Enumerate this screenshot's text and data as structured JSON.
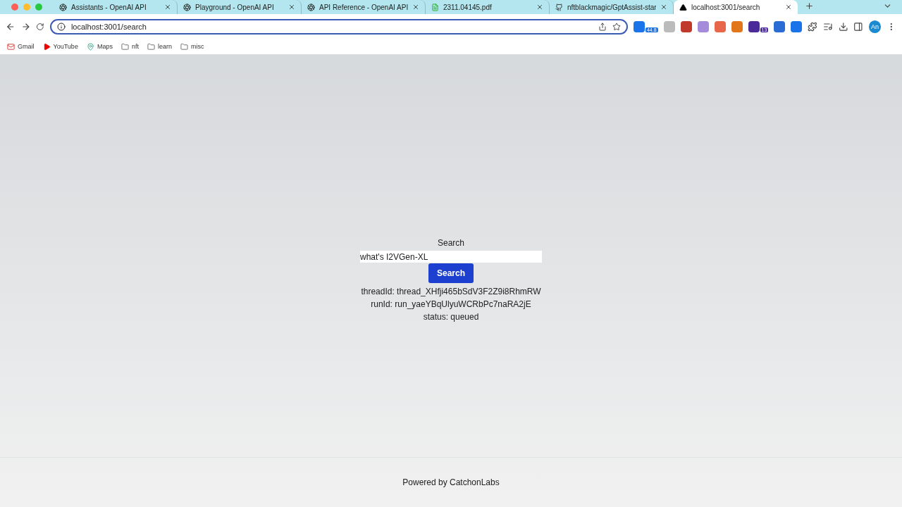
{
  "tabs": [
    {
      "title": "Assistants - OpenAI API",
      "kind": "openai",
      "selected": false
    },
    {
      "title": "Playground - OpenAI API",
      "kind": "openai",
      "selected": false
    },
    {
      "title": "API Reference - OpenAI API",
      "kind": "openai",
      "selected": false
    },
    {
      "title": "2311.04145.pdf",
      "kind": "pdf",
      "selected": false
    },
    {
      "title": "nftblackmagic/GptAssist-star",
      "kind": "github",
      "selected": false
    },
    {
      "title": "localhost:3001/search",
      "kind": "triangle",
      "selected": true
    }
  ],
  "address_bar": {
    "url": "localhost:3001/search"
  },
  "extensions": [
    {
      "kind": "badge",
      "badge": "44.8",
      "color": "#1a73e8"
    },
    {
      "kind": "plain",
      "color": "#bbbbbb"
    },
    {
      "kind": "plain",
      "color": "#c0392b"
    },
    {
      "kind": "plain",
      "color": "#a78bdb"
    },
    {
      "kind": "plain",
      "color": "#e8674a"
    },
    {
      "kind": "plain",
      "color": "#e2761b"
    },
    {
      "kind": "badge",
      "badge": "13",
      "color": "#4b2a9a"
    },
    {
      "kind": "plain",
      "color": "#2b6cd4"
    },
    {
      "kind": "plain",
      "color": "#1a73e8"
    }
  ],
  "profile": {
    "initials": "An"
  },
  "bookmarks": [
    {
      "label": "Gmail",
      "kind": "mail"
    },
    {
      "label": "YouTube",
      "kind": "video"
    },
    {
      "label": "Maps",
      "kind": "map"
    },
    {
      "label": "nft",
      "kind": "folder"
    },
    {
      "label": "learn",
      "kind": "folder"
    },
    {
      "label": "misc",
      "kind": "folder"
    }
  ],
  "page": {
    "heading": "Search",
    "query": "what's I2VGen-XL",
    "button": "Search",
    "results": [
      "threadId: thread_XHfji465bSdV3F2Z9i8RhmRW",
      "runId: run_yaeYBqUlyuWCRbPc7naRA2jE",
      "status: queued"
    ]
  },
  "footer": {
    "text": "Powered by CatchonLabs"
  }
}
